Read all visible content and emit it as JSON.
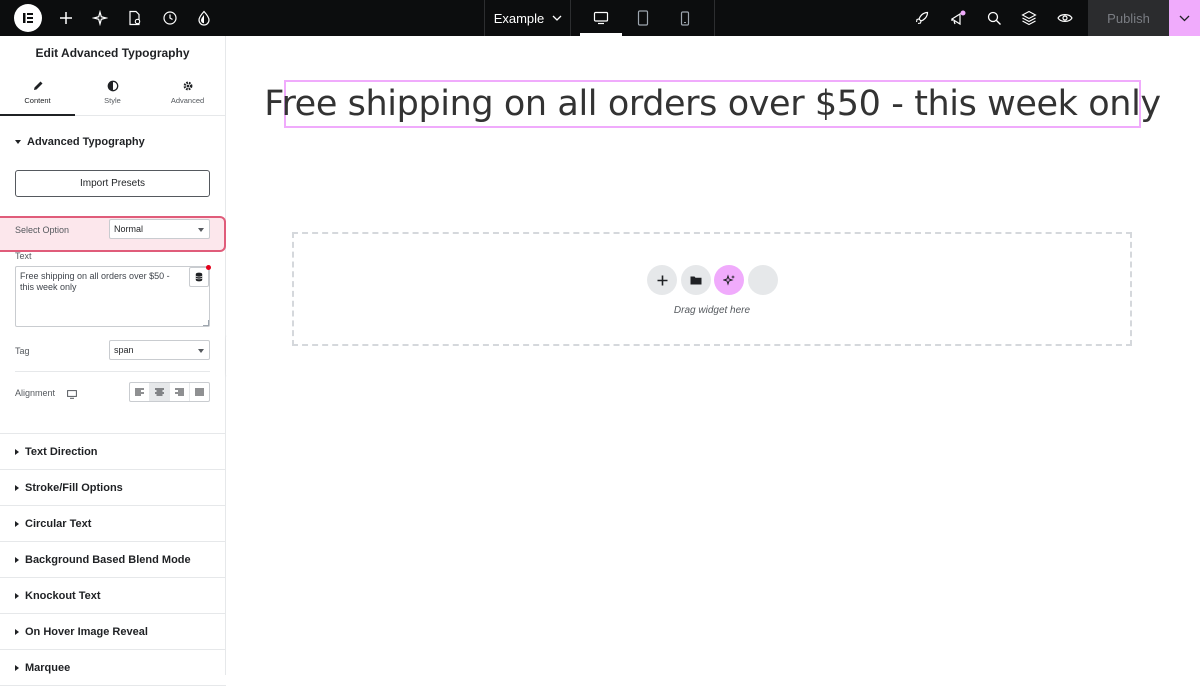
{
  "topbar": {
    "site_name": "Example",
    "publish_label": "Publish",
    "left_icons": [
      "plus-icon",
      "sparkle-icon",
      "page-settings-icon",
      "history-icon",
      "theme-style-icon"
    ],
    "right_icons": [
      "rocket-icon",
      "notifications-icon",
      "search-icon",
      "layers-icon",
      "preview-eye-icon"
    ],
    "devices": [
      "desktop-icon",
      "tablet-icon",
      "mobile-icon"
    ],
    "active_device": "desktop"
  },
  "panel": {
    "title": "Edit Advanced Typography",
    "tabs": [
      {
        "label": "Content",
        "icon": "pencil-icon",
        "active": true
      },
      {
        "label": "Style",
        "icon": "half-circle-icon",
        "active": false
      },
      {
        "label": "Advanced",
        "icon": "gear-icon",
        "active": false
      }
    ],
    "open_section": "Advanced Typography",
    "import_presets_label": "Import Presets",
    "select_option": {
      "label": "Select Option",
      "value": "Normal"
    },
    "text_field": {
      "label": "Text",
      "value": "Free shipping on all orders over $50 - this week only"
    },
    "tag": {
      "label": "Tag",
      "value": "span"
    },
    "alignment": {
      "label": "Alignment",
      "options": [
        "left",
        "center",
        "right",
        "justify"
      ],
      "active": "center"
    },
    "sections": [
      "Text Direction",
      "Stroke/Fill Options",
      "Circular Text",
      "Background Based Blend Mode",
      "Knockout Text",
      "On Hover Image Reveal",
      "Marquee"
    ]
  },
  "canvas": {
    "heading": "Free shipping on all orders over $50 - this week only",
    "drop_zone_text": "Drag widget here"
  },
  "colors": {
    "topbar_bg": "#0c0d0e",
    "accent_pink": "#f0abfc",
    "highlight_red": "#e05c7a"
  }
}
